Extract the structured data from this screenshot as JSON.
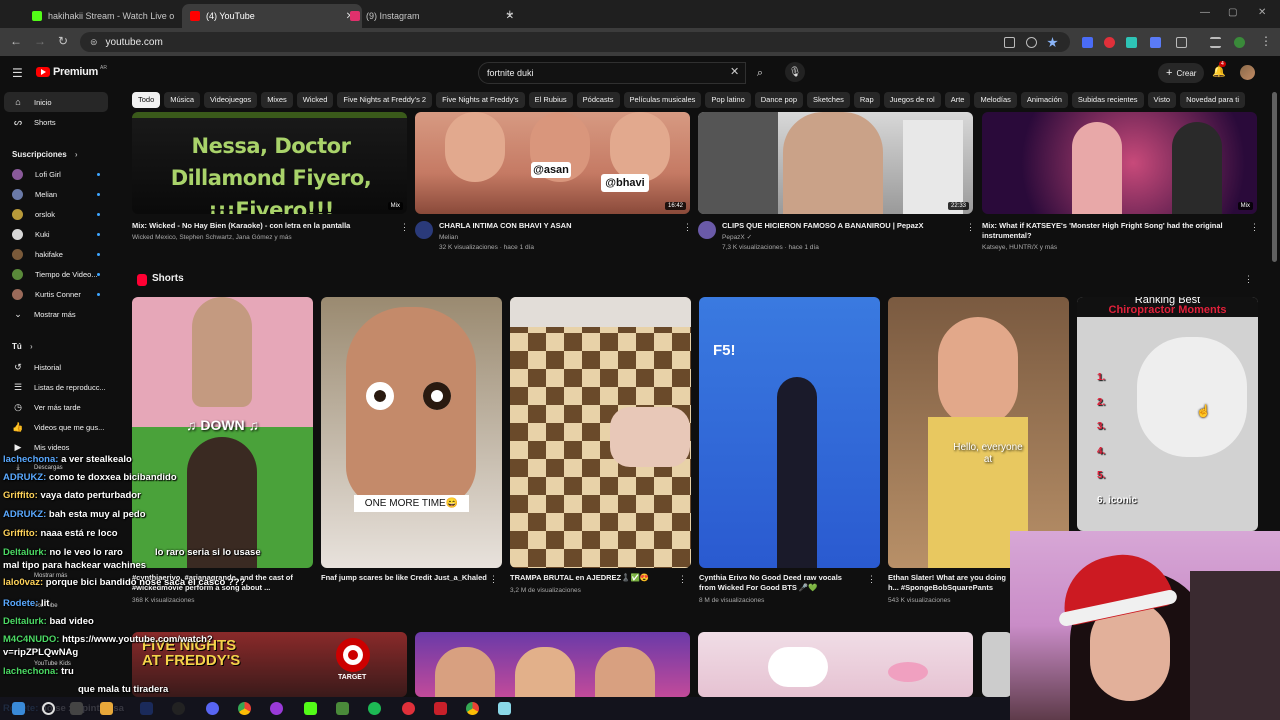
{
  "browser": {
    "tabs": [
      {
        "title": "hakihakii Stream - Watch Live o",
        "color": "#53fc18"
      },
      {
        "title": "(4) YouTube",
        "color": "#ff0000"
      },
      {
        "title": "(9) Instagram",
        "color": "#e1306c"
      }
    ],
    "address": "youtube.com"
  },
  "header": {
    "logo": "Premium",
    "logo_sup": "AR",
    "search_value": "fortnite duki",
    "create_label": "Crear",
    "notifications": "4"
  },
  "chips": [
    "Todo",
    "Música",
    "Videojuegos",
    "Mixes",
    "Wicked",
    "Five Nights at Freddy's 2",
    "Five Nights at Freddy's",
    "El Rubius",
    "Pódcasts",
    "Películas musicales",
    "Pop latino",
    "Dance pop",
    "Sketches",
    "Rap",
    "Juegos de rol",
    "Arte",
    "Melodías",
    "Animación",
    "Subidas recientes",
    "Visto",
    "Novedad para ti"
  ],
  "sidebar": {
    "main": [
      {
        "label": "Inicio",
        "icon": "home-icon"
      },
      {
        "label": "Shorts",
        "icon": "shorts-icon"
      }
    ],
    "subscriptions_heading": "Suscripciones",
    "subscriptions": [
      {
        "label": "Lofi Girl",
        "color": "#8a5a9a"
      },
      {
        "label": "Melian",
        "color": "#6a7aa8"
      },
      {
        "label": "orslok",
        "color": "#b89a3a"
      },
      {
        "label": "Kuki",
        "color": "#d8d8d8"
      },
      {
        "label": "hakifake",
        "color": "#7a5a3a"
      },
      {
        "label": "Tiempo de Video...",
        "color": "#5a8a3a"
      },
      {
        "label": "Kurtis Conner",
        "color": "#9a6a5a"
      }
    ],
    "show_more": "Mostrar más",
    "you_heading": "Tú",
    "you": [
      {
        "label": "Historial",
        "icon": "history-icon"
      },
      {
        "label": "Listas de reproducc...",
        "icon": "playlist-icon"
      },
      {
        "label": "Ver más tarde",
        "icon": "clock-icon"
      },
      {
        "label": "Videos que me gus...",
        "icon": "thumbs-up-icon"
      },
      {
        "label": "Mis videos",
        "icon": "my-videos-icon"
      }
    ],
    "hidden_labels": {
      "downloads": "Descargas",
      "show_more2": "Mostrar más",
      "yt_music": "YouTube",
      "yt_kids": "YouTube Kids"
    }
  },
  "videos": [
    {
      "thumb_text": "Nessa, Doctor Dillamond Fiyero, ¡¡¡Fiyero!!!",
      "badge": "Mix",
      "title": "Mix: Wicked - No Hay Bien (Karaoke) - con letra en la pantalla",
      "meta1": "Wicked Mexico, Stephen Schwartz, Jana Gómez y más",
      "meta2": ""
    },
    {
      "thumb_text": "",
      "badge": "16:42",
      "labels": [
        "@asan",
        "@bhavi"
      ],
      "title": "CHARLA INTIMA CON BHAVI Y ASAN",
      "meta1": "Melian",
      "meta2": "32 K visualizaciones · hace 1 día"
    },
    {
      "thumb_text": "",
      "badge": "22:33",
      "title": "CLIPS QUE HICIERON FAMOSO A BANANIROU | PepazX",
      "meta1": "PepazX ✓",
      "meta2": "7,3 K visualizaciones · hace 1 día"
    },
    {
      "thumb_text": "",
      "badge": "Mix",
      "title": "Mix: What if KATSEYE's 'Monster High Fright Song' had the original instrumental?",
      "meta1": "Katseye, HUNTR/X y más",
      "meta2": ""
    }
  ],
  "shorts_heading": "Shorts",
  "shorts": [
    {
      "overlay": "♫ DOWN ♫",
      "title": "#cynthiaerivo, #arianagrande, and the cast of #wickedmovie perform a song about ...",
      "views": "368 K visualizaciones"
    },
    {
      "overlay": "ONE MORE TIME😄",
      "title": "Fnaf jump scares be like Credit Just_a_Khaled",
      "views": ""
    },
    {
      "overlay": "",
      "title": "TRAMPA BRUTAL en AJEDREZ♟️✅😍",
      "views": "3,2 M de visualizaciones"
    },
    {
      "overlay": "F5!",
      "title": "Cynthia Erivo No Good Deed raw vocals from Wicked For Good BTS 🎤💚",
      "views": "8 M de visualizaciones"
    },
    {
      "overlay": "Hello, everyone at",
      "title": "Ethan Slater! What are you doing h... #SpongeBobSquarePants",
      "views": "543 K visualizaciones"
    },
    {
      "overlay_title": "Ranking Best",
      "overlay_sub": "Chiropractor Moments",
      "list": [
        "1.",
        "2.",
        "3.",
        "4.",
        "5.",
        "6. iconic"
      ],
      "title": "",
      "views": ""
    }
  ],
  "bottom_row": [
    {
      "thumb_text": "FIVE NIGHTS AT FREDDY'S",
      "badge": "TARGET"
    },
    {
      "thumb_text": ""
    },
    {
      "thumb_text": ""
    }
  ],
  "chat": [
    {
      "user": "lachechona:",
      "msg": "a ver stealkealo"
    },
    {
      "user": "ADRUKZ:",
      "msg": "como te doxxea bicibandido"
    },
    {
      "user": "Griffito:",
      "msg": "vaya dato perturbador"
    },
    {
      "user": "ADRUKZ:",
      "msg": "bah esta muy al pedo"
    },
    {
      "user": "Griffito:",
      "msg": "naaa está re loco"
    },
    {
      "user": "Deltalurk:",
      "msg": "no le veo lo raro"
    },
    {
      "user": "",
      "msg": "lo raro seria si lo usase"
    },
    {
      "user": "",
      "msg": "mal tipo para hackear wachines"
    },
    {
      "user": "lalo0vaz:",
      "msg": "porque bici bandido nose saca el casco ???"
    },
    {
      "user": "Rodete:",
      "msg": "lit"
    },
    {
      "user": "Deltalurk:",
      "msg": "bad video"
    },
    {
      "user": "M4C4NUDO:",
      "msg": "https://www.youtube.com/watch?"
    },
    {
      "user": "",
      "msg": "v=ripZPLQwNAg"
    },
    {
      "user": "lachechona:",
      "msg": "tru"
    },
    {
      "user": "",
      "msg": "que mala tu tiradera"
    },
    {
      "user": "Rodete:",
      "msg": "no se xq pinto esa"
    }
  ],
  "ui": {
    "close_glyph": "✕",
    "plus_glyph": "+",
    "back_glyph": "←",
    "fwd_glyph": "→",
    "reload_glyph": "↻",
    "tune_glyph": "⊜",
    "menu_glyph": "☰",
    "search_glyph": "⌕",
    "mic_glyph": "🎙",
    "bell_glyph": "🔔",
    "more_glyph": "⋮",
    "chevron_glyph": "›",
    "chevron_down_glyph": "⌄",
    "win_min": "—",
    "win_max": "▢",
    "win_close": "✕"
  },
  "colors": {
    "accent": "#ff0000",
    "background": "#0f0f0f",
    "chip": "#272727"
  }
}
